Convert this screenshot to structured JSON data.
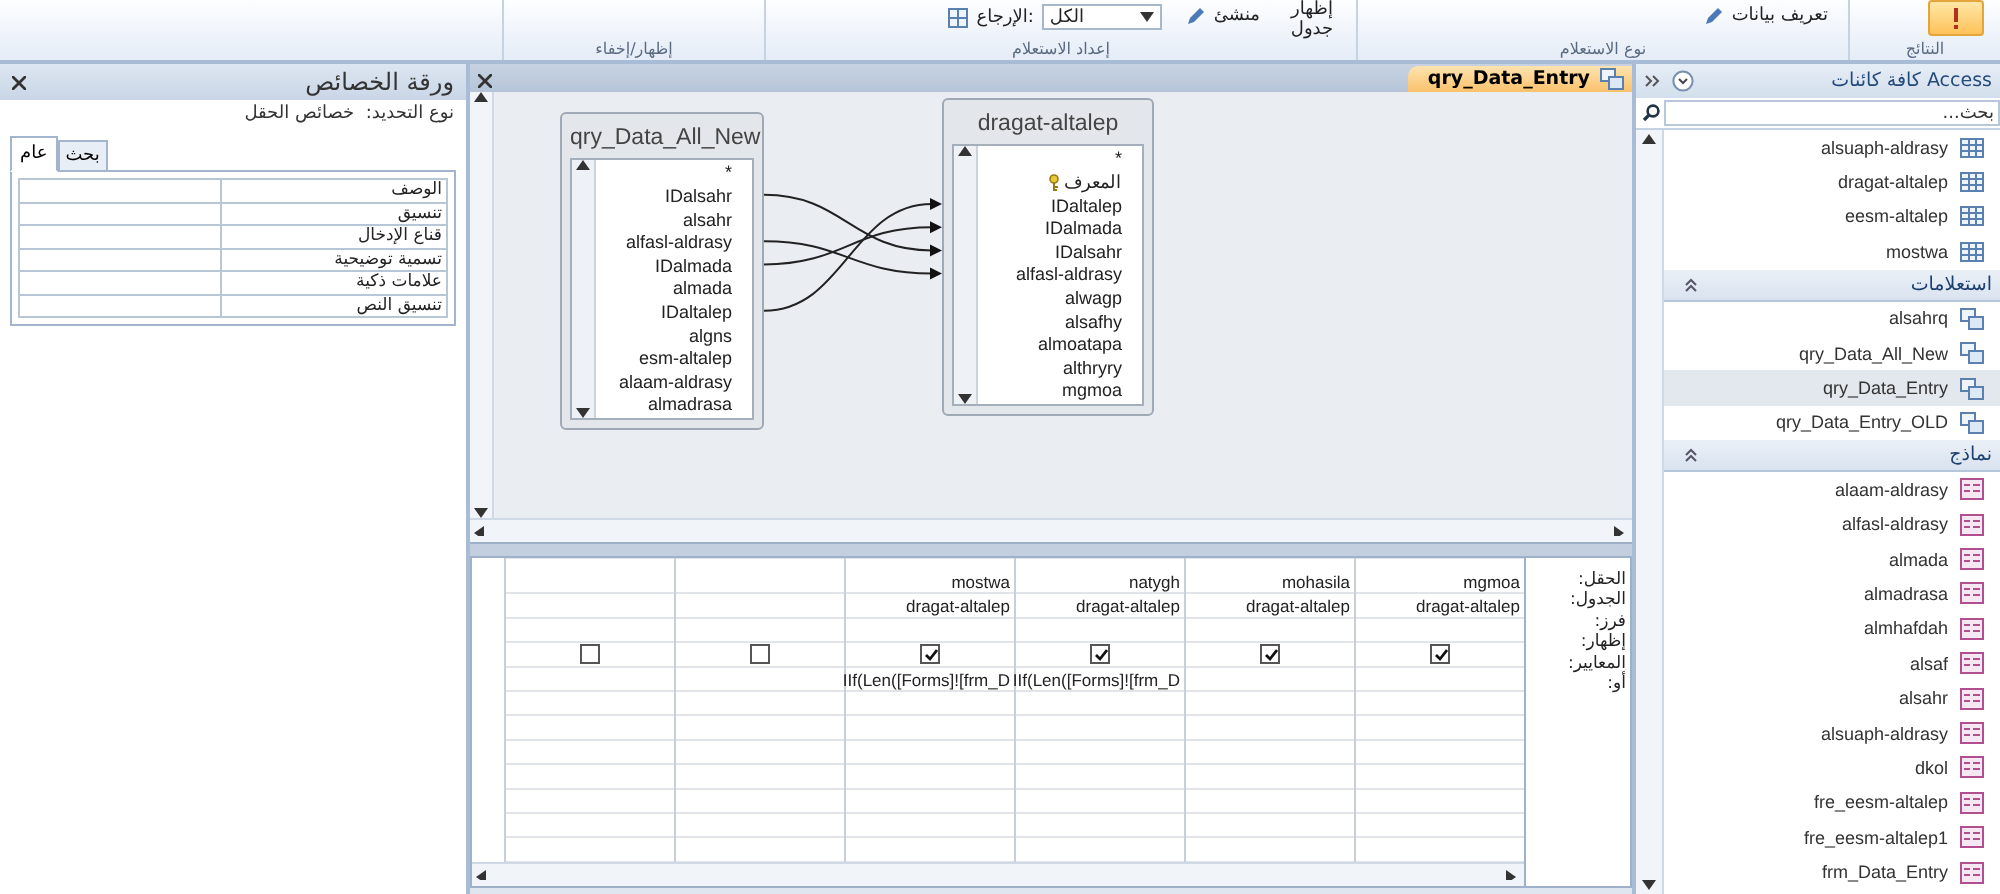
{
  "ribbon": {
    "groups": [
      {
        "label": "النتائج",
        "buttons": [
          {
            "kind": "run",
            "selected": true
          }
        ]
      },
      {
        "label": "نوع الاستعلام",
        "buttons": [
          {
            "kind": "small",
            "label": "تعريف بيانات"
          }
        ]
      },
      {
        "label": "إعداد الاستعلام",
        "buttons": [
          {
            "kind": "large",
            "label": "إظهار جدول"
          },
          {
            "kind": "small",
            "label": "منشئ"
          },
          {
            "kind": "combo",
            "label": "الإرجاع:",
            "value": "الكل"
          }
        ]
      },
      {
        "label": "إظهار/إخفاء"
      }
    ]
  },
  "property_sheet": {
    "title": "ورقة الخصائص",
    "selection_label": "نوع التحديد:",
    "selection_value": "خصائص الحقل",
    "tabs": [
      {
        "label": "بحث",
        "selected": false
      },
      {
        "label": "عام",
        "selected": true
      }
    ],
    "properties": [
      "الوصف",
      "تنسيق",
      "قناع الإدخال",
      "تسمية توضيحية",
      "علامات ذكية",
      "تنسيق النص"
    ]
  },
  "document_tab": {
    "title": "qry_Data_Entry"
  },
  "design": {
    "tables": [
      {
        "title": "qry_Data_All_New",
        "fields": [
          {
            "name": "*"
          },
          {
            "name": "IDalsahr"
          },
          {
            "name": "alsahr"
          },
          {
            "name": "alfasl-aldrasy"
          },
          {
            "name": "IDalmada"
          },
          {
            "name": "almada"
          },
          {
            "name": "IDaltalep"
          },
          {
            "name": "algns"
          },
          {
            "name": "esm-altalep"
          },
          {
            "name": "alaam-aldrasy"
          },
          {
            "name": "almadrasa"
          }
        ]
      },
      {
        "title": "dragat-altalep",
        "fields": [
          {
            "name": "*"
          },
          {
            "name": "المعرف",
            "key": true
          },
          {
            "name": "IDaltalep"
          },
          {
            "name": "IDalmada"
          },
          {
            "name": "IDalsahr"
          },
          {
            "name": "alfasl-aldrasy"
          },
          {
            "name": "alwagp"
          },
          {
            "name": "alsafhy"
          },
          {
            "name": "almoatapa"
          },
          {
            "name": "althryry"
          },
          {
            "name": "mgmoa"
          }
        ]
      }
    ]
  },
  "grid": {
    "row_labels": [
      "الحقل:",
      "الجدول:",
      "فرز:",
      "إظهار:",
      "المعايير:",
      "أو:"
    ],
    "columns": [
      {
        "field": "mgmoa",
        "table": "dragat-altalep",
        "show": true
      },
      {
        "field": "mohasila",
        "table": "dragat-altalep",
        "show": true
      },
      {
        "field": "natygh",
        "table": "dragat-altalep",
        "show": true,
        "criteria": "IIf(Len([Forms]![frm_D"
      },
      {
        "field": "mostwa",
        "table": "dragat-altalep",
        "show": true,
        "criteria": "IIf(Len([Forms]![frm_D"
      },
      {
        "show": false
      },
      {
        "show": false
      }
    ]
  },
  "nav": {
    "title": "كافة كائنات Access",
    "search_placeholder": "بحث...",
    "groups": [
      {
        "items": [
          {
            "label": "alsuaph-aldrasy",
            "kind": "table",
            "selected": false
          },
          {
            "label": "dragat-altalep",
            "kind": "table",
            "selected": false
          },
          {
            "label": "eesm-altalep",
            "kind": "table",
            "selected": false
          },
          {
            "label": "mostwa",
            "kind": "table",
            "selected": false
          }
        ]
      },
      {
        "title": "استعلامات",
        "items": [
          {
            "label": "alsahrq",
            "kind": "query",
            "selected": false
          },
          {
            "label": "qry_Data_All_New",
            "kind": "query",
            "selected": false
          },
          {
            "label": "qry_Data_Entry",
            "kind": "query",
            "selected": true
          },
          {
            "label": "qry_Data_Entry_OLD",
            "kind": "query",
            "selected": false
          }
        ]
      },
      {
        "title": "نماذج",
        "items": [
          {
            "label": "alaam-aldrasy",
            "kind": "form",
            "selected": false
          },
          {
            "label": "alfasl-aldrasy",
            "kind": "form",
            "selected": false
          },
          {
            "label": "almada",
            "kind": "form",
            "selected": false
          },
          {
            "label": "almadrasa",
            "kind": "form",
            "selected": false
          },
          {
            "label": "almhafdah",
            "kind": "form",
            "selected": false
          },
          {
            "label": "alsaf",
            "kind": "form",
            "selected": false
          },
          {
            "label": "alsahr",
            "kind": "form",
            "selected": false
          },
          {
            "label": "alsuaph-aldrasy",
            "kind": "form",
            "selected": false
          },
          {
            "label": "dkol",
            "kind": "form",
            "selected": false
          },
          {
            "label": "fre_eesm-altalep",
            "kind": "form",
            "selected": false
          },
          {
            "label": "fre_eesm-altalep1",
            "kind": "form",
            "selected": false
          },
          {
            "label": "frm_Data_Entry",
            "kind": "form",
            "selected": false
          }
        ]
      }
    ]
  }
}
